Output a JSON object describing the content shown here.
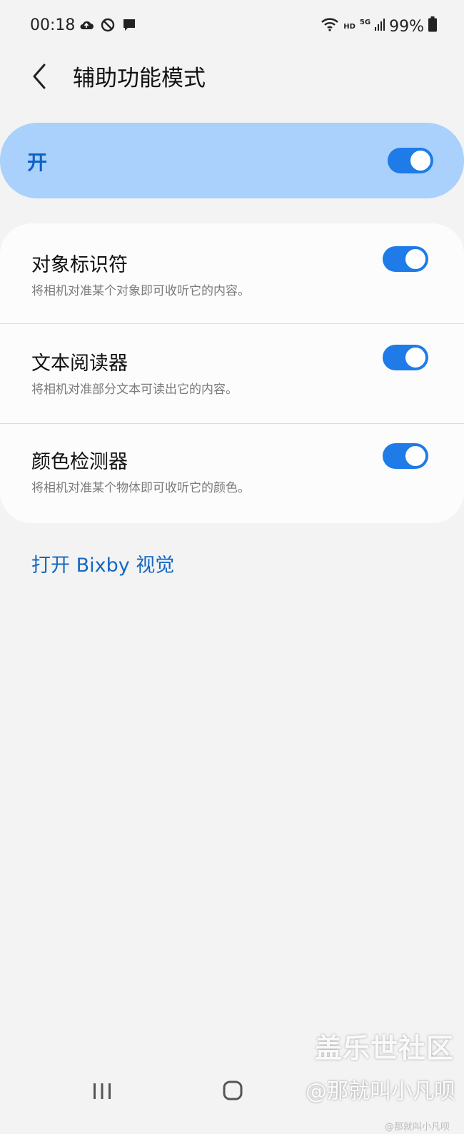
{
  "status_bar": {
    "time": "00:18",
    "left_icons": [
      "cloud-sync-icon",
      "no-disturb-icon",
      "message-icon"
    ],
    "hd": "HD",
    "network": "5G",
    "battery": "99%"
  },
  "header": {
    "title": "辅助功能模式"
  },
  "master": {
    "label": "开",
    "enabled": true
  },
  "features": [
    {
      "title": "对象标识符",
      "description": "将相机对准某个对象即可收听它的内容。",
      "enabled": true
    },
    {
      "title": "文本阅读器",
      "description": "将相机对准部分文本可读出它的内容。",
      "enabled": true
    },
    {
      "title": "颜色检测器",
      "description": "将相机对准某个物体即可收听它的颜色。",
      "enabled": true
    }
  ],
  "link": {
    "label": "打开 Bixby 视觉"
  },
  "watermark": {
    "main": "盖乐世社区",
    "handle": "@那就叫小凡呗",
    "small": "@那就叫小凡呗"
  },
  "colors": {
    "accent": "#1e7be8",
    "master_bg": "#a9d1fb",
    "link": "#1468c1",
    "background": "#f3f3f3"
  }
}
